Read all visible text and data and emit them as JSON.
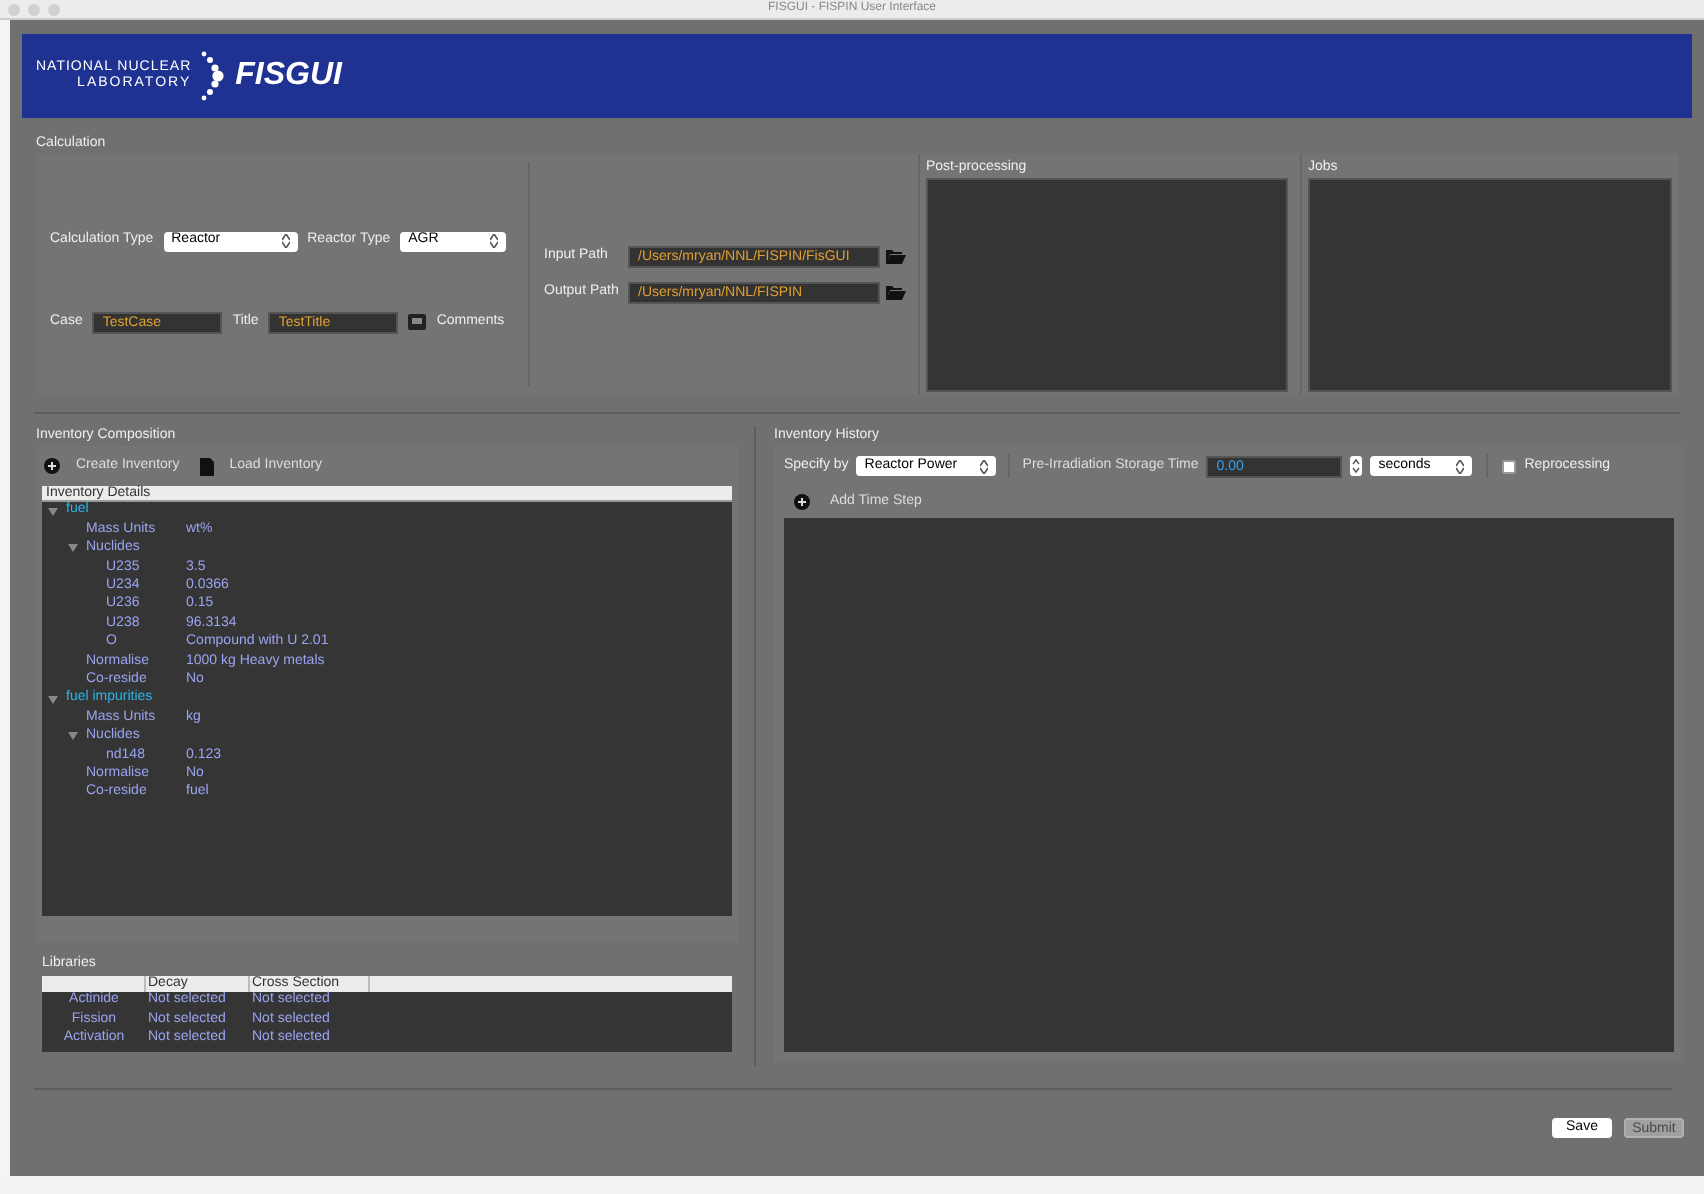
{
  "window": {
    "title": "FISGUI - FISPIN User Interface"
  },
  "header": {
    "org_line_1": "NATIONAL NUCLEAR",
    "org_line_2": "LABORATORY",
    "app_name": "FISGUI"
  },
  "calculation": {
    "title": "Calculation",
    "calculation_type": {
      "label": "Calculation Type",
      "value": "Reactor"
    },
    "reactor_type": {
      "label": "Reactor Type",
      "value": "AGR"
    },
    "case": {
      "label": "Case",
      "value": "TestCase"
    },
    "case_title": {
      "label": "Title",
      "value": "TestTitle"
    },
    "comments": {
      "label": "Comments"
    },
    "input_path": {
      "label": "Input Path",
      "value": "/Users/mryan/NNL/FISPIN/FisGUI"
    },
    "output_path": {
      "label": "Output Path",
      "value": "/Users/mryan/NNL/FISPIN"
    },
    "post_processing": {
      "title": "Post-processing"
    },
    "jobs": {
      "title": "Jobs"
    }
  },
  "inventory_composition": {
    "title": "Inventory Composition",
    "actions": [
      {
        "kind": "create",
        "label": "Create Inventory"
      },
      {
        "kind": "load",
        "label": "Load Inventory"
      }
    ],
    "tree_header": "Inventory Details",
    "tree": [
      {
        "label": "fuel",
        "expanded": true,
        "children": [
          {
            "label": "Mass Units",
            "value": "wt%"
          },
          {
            "label": "Nuclides",
            "expanded": true,
            "children": [
              {
                "label": "U235",
                "value": "3.5"
              },
              {
                "label": "U234",
                "value": "0.0366"
              },
              {
                "label": "U236",
                "value": "0.15"
              },
              {
                "label": "U238",
                "value": "96.3134"
              },
              {
                "label": "O",
                "value": "Compound with U 2.01"
              }
            ]
          },
          {
            "label": "Normalise",
            "value": "1000 kg Heavy metals"
          },
          {
            "label": "Co-reside",
            "value": "No"
          }
        ]
      },
      {
        "label": "fuel impurities",
        "expanded": true,
        "children": [
          {
            "label": "Mass Units",
            "value": "kg"
          },
          {
            "label": "Nuclides",
            "expanded": true,
            "children": [
              {
                "label": "nd148",
                "value": "0.123"
              }
            ]
          },
          {
            "label": "Normalise",
            "value": "No"
          },
          {
            "label": "Co-reside",
            "value": "fuel"
          }
        ]
      }
    ]
  },
  "libraries": {
    "title": "Libraries",
    "columns": [
      "Decay",
      "Cross Section"
    ],
    "rows": [
      {
        "name": "Actinide",
        "cells": [
          "Not selected",
          "Not selected"
        ]
      },
      {
        "name": "Fission",
        "cells": [
          "Not selected",
          "Not selected"
        ]
      },
      {
        "name": "Activation",
        "cells": [
          "Not selected",
          "Not selected"
        ]
      }
    ]
  },
  "inventory_history": {
    "title": "Inventory History",
    "specify_by": {
      "label": "Specify by",
      "value": "Reactor Power"
    },
    "storage_time": {
      "label": "Pre-Irradiation Storage Time",
      "value": "0.00"
    },
    "time_unit": {
      "value": "seconds"
    },
    "reprocessing": {
      "label": "Reprocessing",
      "checked": false
    },
    "add_time_step": {
      "label": "Add Time Step"
    }
  },
  "buttons": [
    {
      "label": "Save",
      "disabled": false
    },
    {
      "label": "Submit",
      "disabled": true
    }
  ]
}
